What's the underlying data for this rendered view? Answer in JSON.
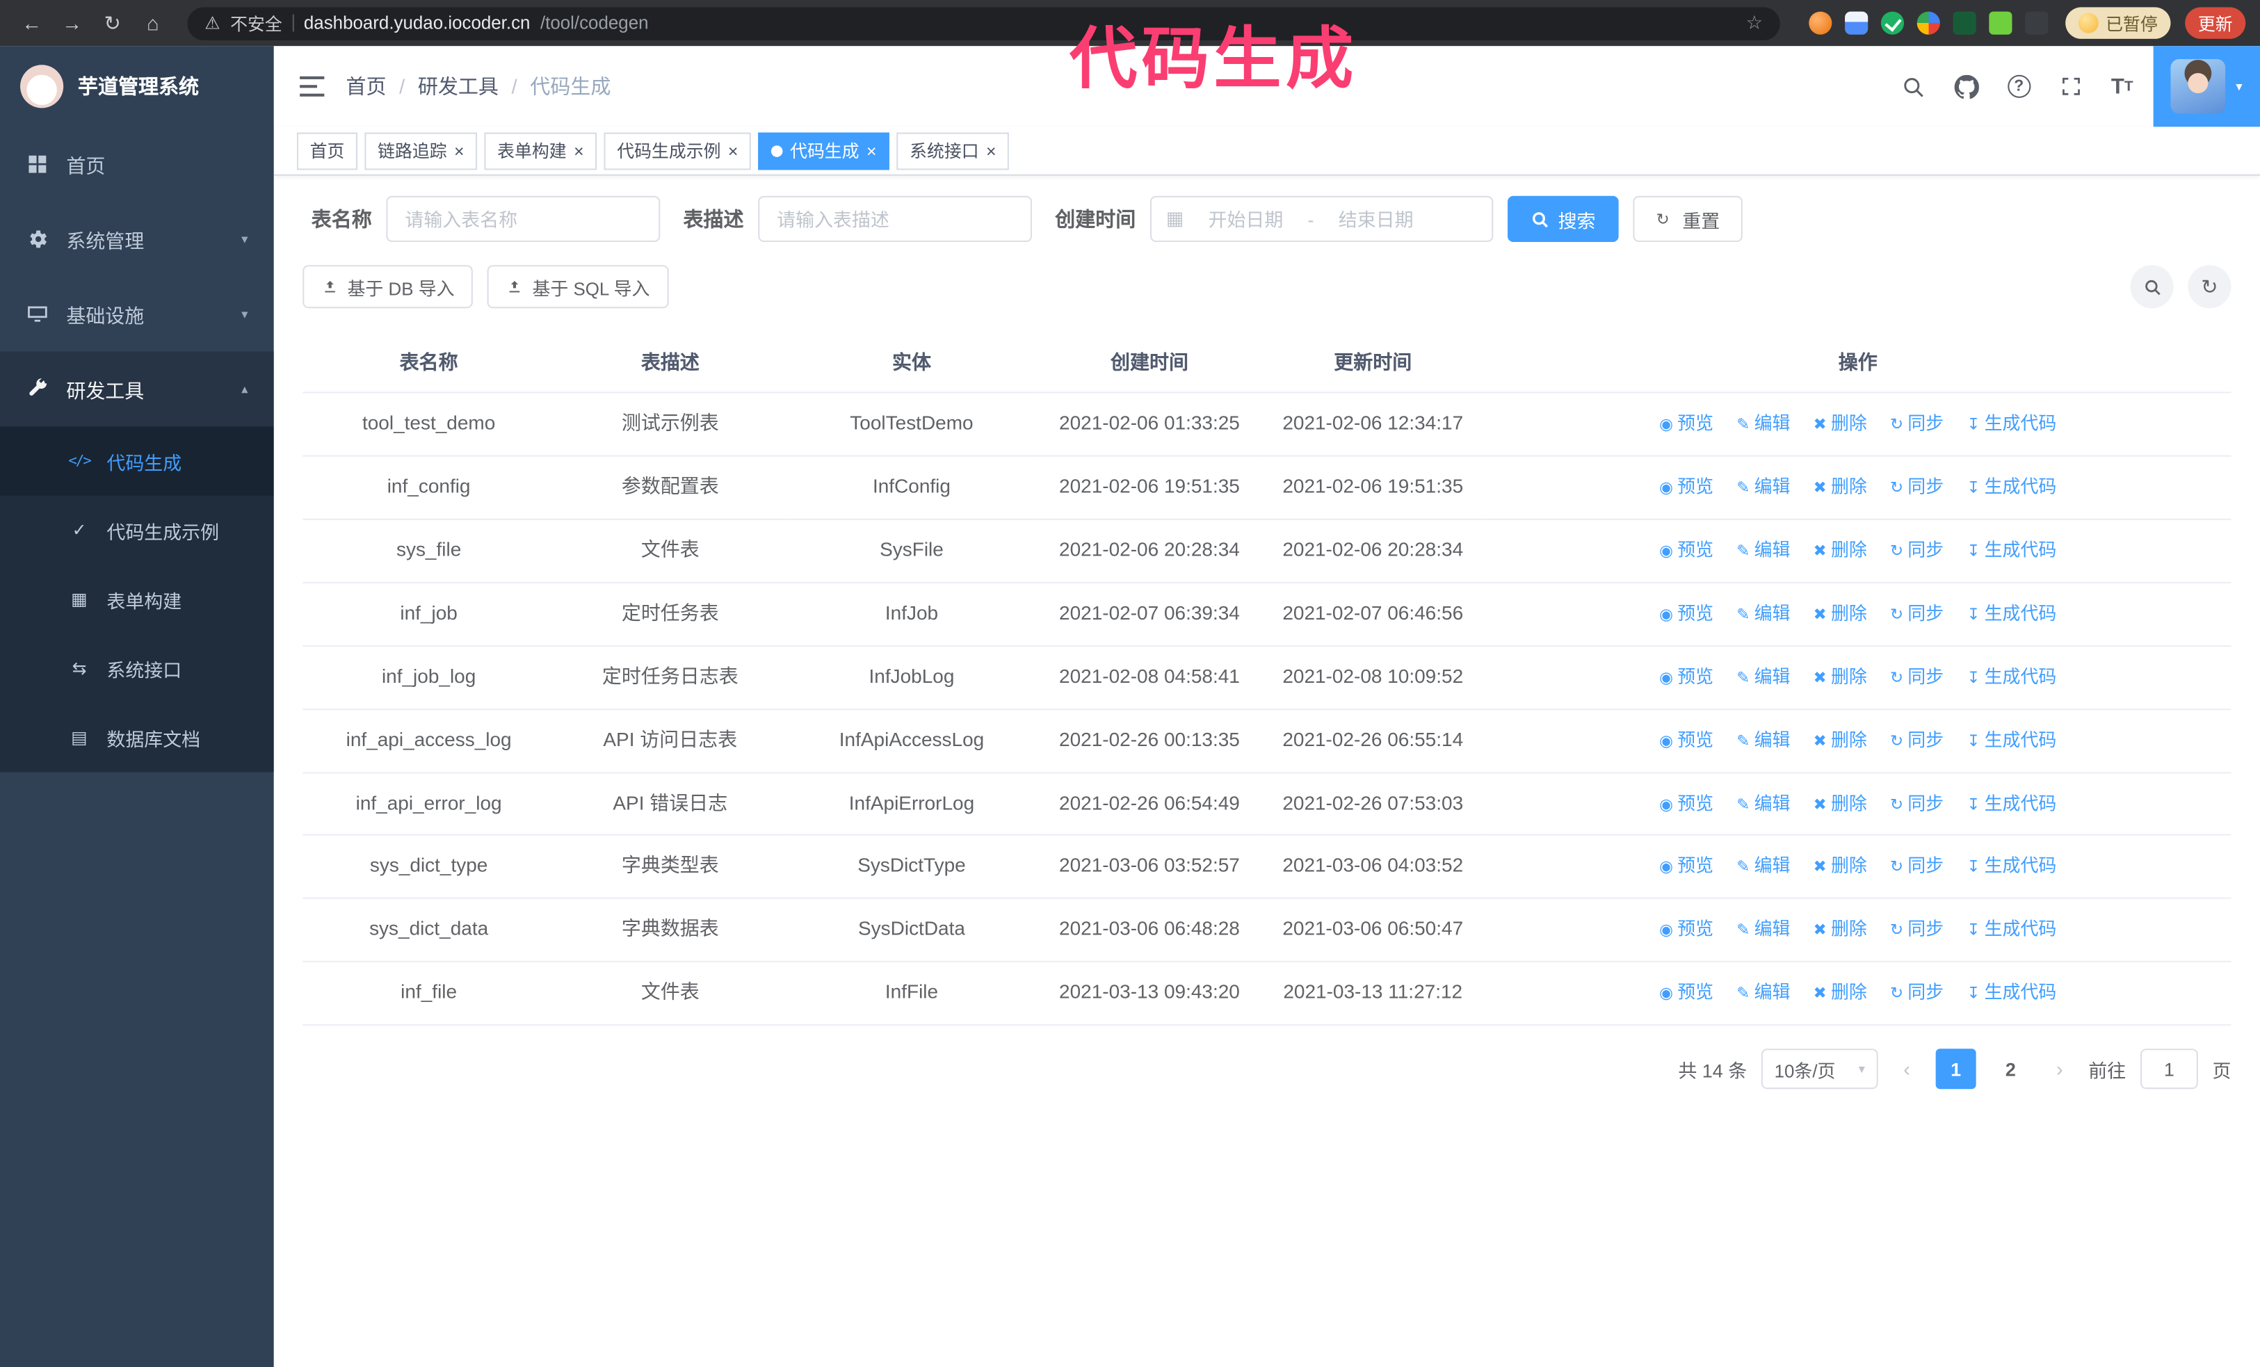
{
  "accent": "#409eff",
  "annotation": {
    "text": "代码生成",
    "color": "#fb3e72"
  },
  "icons": {
    "back": "←",
    "forward": "→",
    "reload": "↻",
    "home": "⌂",
    "warning": "⚠",
    "star": "☆",
    "close": "×",
    "caret_down": "▾",
    "caret_up": "▴",
    "calendar": "▦",
    "range_separator": "-",
    "breadcrumb_separator": "/",
    "code": "</>",
    "check": "✓",
    "form_grid": "▦",
    "api_arrows": "⇆",
    "db_table": "▤",
    "preview": "◉",
    "edit": "✎",
    "delete": "✖",
    "sync": "↻",
    "generate": "↧",
    "chevron_left": "‹",
    "chevron_right": "›",
    "refresh": "↻",
    "font_size": "T"
  },
  "browser": {
    "security_label": "不安全",
    "url_host": "dashboard.yudao.iocoder.cn",
    "url_path": "/tool/codegen",
    "paused_badge": "已暂停",
    "update_button": "更新"
  },
  "sidebar": {
    "title": "芋道管理系统",
    "items": [
      {
        "label": "首页"
      },
      {
        "label": "系统管理"
      },
      {
        "label": "基础设施"
      },
      {
        "label": "研发工具"
      }
    ],
    "subitems": [
      {
        "label": "代码生成"
      },
      {
        "label": "代码生成示例"
      },
      {
        "label": "表单构建"
      },
      {
        "label": "系统接口"
      },
      {
        "label": "数据库文档"
      }
    ]
  },
  "breadcrumb": {
    "items": [
      "首页",
      "研发工具",
      "代码生成"
    ]
  },
  "tabs": [
    {
      "label": "首页"
    },
    {
      "label": "链路追踪"
    },
    {
      "label": "表单构建"
    },
    {
      "label": "代码生成示例"
    },
    {
      "label": "代码生成"
    },
    {
      "label": "系统接口"
    }
  ],
  "filters": {
    "name_label": "表名称",
    "name_placeholder": "请输入表名称",
    "desc_label": "表描述",
    "desc_placeholder": "请输入表描述",
    "time_label": "创建时间",
    "start_placeholder": "开始日期",
    "end_placeholder": "结束日期",
    "search_button": "搜索",
    "reset_button": "重置"
  },
  "toolbar": {
    "import_db": "基于 DB 导入",
    "import_sql": "基于 SQL 导入"
  },
  "table": {
    "headers": [
      "表名称",
      "表描述",
      "实体",
      "创建时间",
      "更新时间",
      "操作"
    ],
    "actions": {
      "preview": "预览",
      "edit": "编辑",
      "delete": "删除",
      "sync": "同步",
      "generate": "生成代码"
    },
    "rows": [
      {
        "name": "tool_test_demo",
        "desc": "测试示例表",
        "entity": "ToolTestDemo",
        "created": "2021-02-06 01:33:25",
        "updated": "2021-02-06 12:34:17"
      },
      {
        "name": "inf_config",
        "desc": "参数配置表",
        "entity": "InfConfig",
        "created": "2021-02-06 19:51:35",
        "updated": "2021-02-06 19:51:35"
      },
      {
        "name": "sys_file",
        "desc": "文件表",
        "entity": "SysFile",
        "created": "2021-02-06 20:28:34",
        "updated": "2021-02-06 20:28:34"
      },
      {
        "name": "inf_job",
        "desc": "定时任务表",
        "entity": "InfJob",
        "created": "2021-02-07 06:39:34",
        "updated": "2021-02-07 06:46:56"
      },
      {
        "name": "inf_job_log",
        "desc": "定时任务日志表",
        "entity": "InfJobLog",
        "created": "2021-02-08 04:58:41",
        "updated": "2021-02-08 10:09:52"
      },
      {
        "name": "inf_api_access_log",
        "desc": "API 访问日志表",
        "entity": "InfApiAccessLog",
        "created": "2021-02-26 00:13:35",
        "updated": "2021-02-26 06:55:14"
      },
      {
        "name": "inf_api_error_log",
        "desc": "API 错误日志",
        "entity": "InfApiErrorLog",
        "created": "2021-02-26 06:54:49",
        "updated": "2021-02-26 07:53:03"
      },
      {
        "name": "sys_dict_type",
        "desc": "字典类型表",
        "entity": "SysDictType",
        "created": "2021-03-06 03:52:57",
        "updated": "2021-03-06 04:03:52"
      },
      {
        "name": "sys_dict_data",
        "desc": "字典数据表",
        "entity": "SysDictData",
        "created": "2021-03-06 06:48:28",
        "updated": "2021-03-06 06:50:47"
      },
      {
        "name": "inf_file",
        "desc": "文件表",
        "entity": "InfFile",
        "created": "2021-03-13 09:43:20",
        "updated": "2021-03-13 11:27:12"
      }
    ]
  },
  "pagination": {
    "total": "共 14 条",
    "page_size": "10条/页",
    "pages": [
      "1",
      "2"
    ],
    "goto_label": "前往",
    "goto_value": "1",
    "unit_label": "页"
  }
}
